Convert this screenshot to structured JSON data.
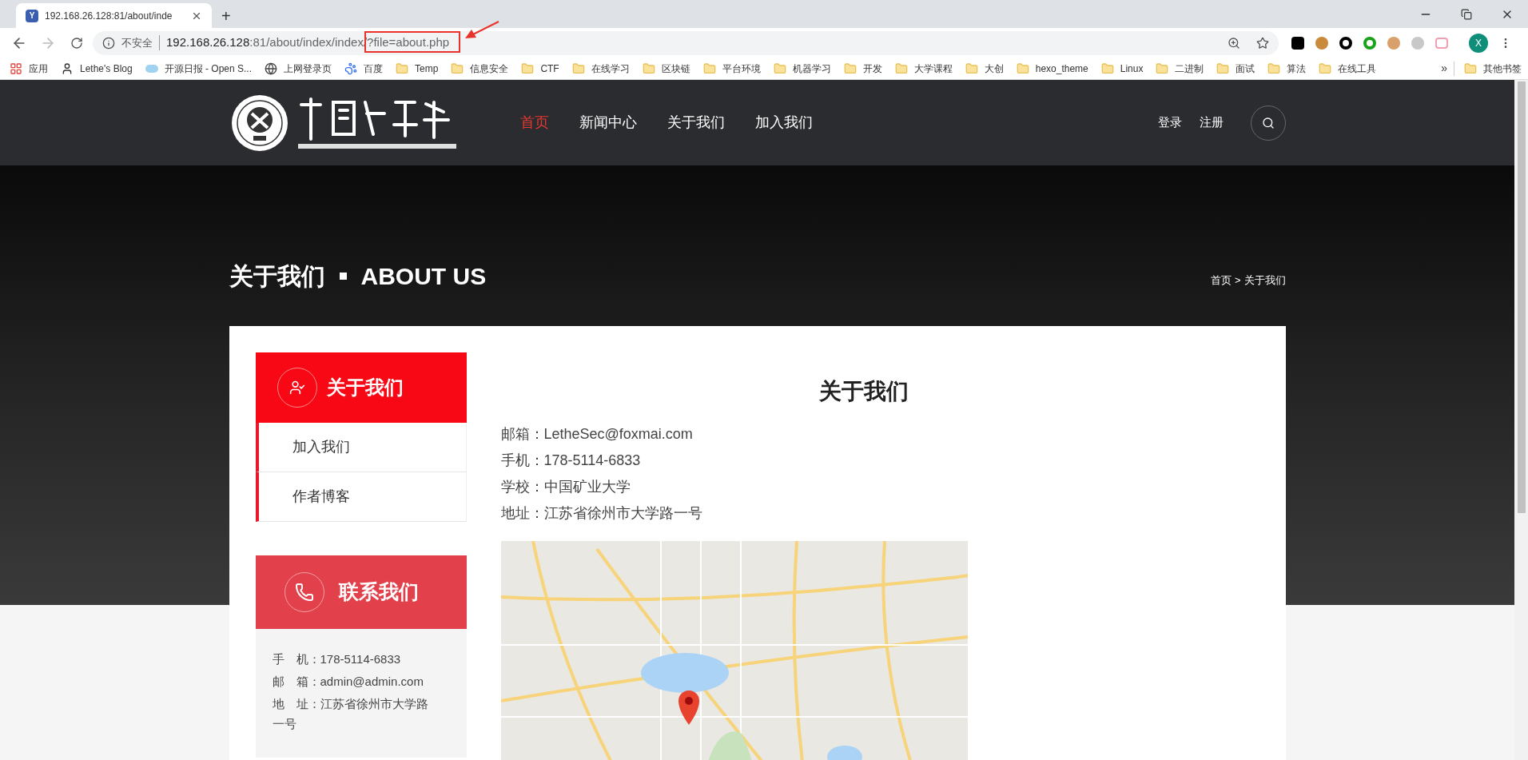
{
  "browser": {
    "tab": {
      "title": "192.168.26.128:81/about/inde",
      "favicon": "Y"
    },
    "new_tab": "+",
    "address": {
      "security": "不安全",
      "url": [
        {
          "kind": "host",
          "text": "192.168.26.128"
        },
        {
          "kind": "path",
          "text": ":81/about/index/index/"
        },
        {
          "kind": "marked",
          "text": "?file=about.php"
        }
      ]
    },
    "profile": "X",
    "bookmarks": [
      {
        "kind": "apps",
        "label": "应用"
      },
      {
        "kind": "avatar",
        "label": "Lethe's Blog"
      },
      {
        "kind": "site",
        "label": "开源日报 - Open S..."
      },
      {
        "kind": "globe",
        "label": "上网登录页"
      },
      {
        "kind": "paw",
        "label": "百度"
      },
      {
        "kind": "folder",
        "label": "Temp"
      },
      {
        "kind": "folder",
        "label": "信息安全"
      },
      {
        "kind": "folder",
        "label": "CTF"
      },
      {
        "kind": "folder",
        "label": "在线学习"
      },
      {
        "kind": "folder",
        "label": "区块链"
      },
      {
        "kind": "folder",
        "label": "平台环境"
      },
      {
        "kind": "folder",
        "label": "机器学习"
      },
      {
        "kind": "folder",
        "label": "开发"
      },
      {
        "kind": "folder",
        "label": "大学课程"
      },
      {
        "kind": "folder",
        "label": "大创"
      },
      {
        "kind": "folder",
        "label": "hexo_theme"
      },
      {
        "kind": "folder",
        "label": "Linux"
      },
      {
        "kind": "folder",
        "label": "二进制"
      },
      {
        "kind": "folder",
        "label": "面试"
      },
      {
        "kind": "folder",
        "label": "算法"
      },
      {
        "kind": "folder",
        "label": "在线工具"
      }
    ],
    "bookmarks_more": "»",
    "other_bookmarks": "其他书签"
  },
  "site": {
    "nav": [
      {
        "label": "首页",
        "selected": true
      },
      {
        "label": "新闻中心",
        "selected": false
      },
      {
        "label": "关于我们",
        "selected": false
      },
      {
        "label": "加入我们",
        "selected": false
      }
    ],
    "auth": [
      "登录",
      "注册"
    ],
    "hero": {
      "title": "关于我们",
      "title_en": "ABOUT US",
      "breadcrumb": [
        "首页 >",
        "关于我们"
      ]
    },
    "sidebar": {
      "title": "关于我们",
      "items": [
        "加入我们",
        "作者博客"
      ],
      "contact_title": "联系我们",
      "contact": [
        "手　机：178-5114-6833",
        "邮　箱：admin@admin.com",
        "地　址：江苏省徐州市大学路一号"
      ]
    },
    "content": {
      "title": "关于我们",
      "lines": [
        "邮箱：LetheSec@foxmai.com",
        "手机：178-5114-6833",
        "学校：中国矿业大学",
        "地址：江苏省徐州市大学路一号"
      ]
    }
  }
}
